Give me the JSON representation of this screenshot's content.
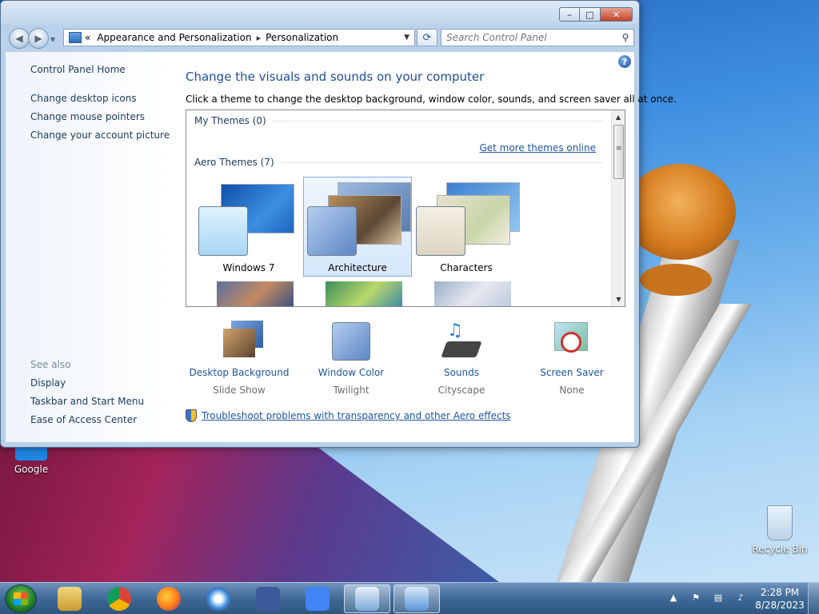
{
  "desktop": {
    "icons": [
      {
        "label": "Google"
      },
      {
        "label": "Recycle Bin"
      }
    ]
  },
  "window": {
    "caption": {
      "minimize": "–",
      "maximize": "□",
      "close": "✕"
    },
    "nav": {
      "back_icon": "back-arrow-icon",
      "forward_icon": "forward-arrow-icon",
      "breadcrumb_prefix": "«",
      "breadcrumb": [
        "Appearance and Personalization",
        "Personalization"
      ],
      "breadcrumb_sep": "▸",
      "dropdown": "▼",
      "refresh": "⟳",
      "search_placeholder": "Search Control Panel"
    },
    "left_pane": {
      "home": "Control Panel Home",
      "links": [
        "Change desktop icons",
        "Change mouse pointers",
        "Change your account picture"
      ],
      "see_also_label": "See also",
      "see_also": [
        "Display",
        "Taskbar and Start Menu",
        "Ease of Access Center"
      ]
    },
    "main": {
      "help": "?",
      "title": "Change the visuals and sounds on your computer",
      "subtitle": "Click a theme to change the desktop background, window color, sounds, and screen saver all at once.",
      "my_themes": "My Themes (0)",
      "get_more": "Get more themes online",
      "aero_themes": "Aero Themes (7)",
      "themes": [
        {
          "name": "Windows 7",
          "selected": false,
          "colors": [
            "#1b5fb0",
            "#bfe3fb"
          ]
        },
        {
          "name": "Architecture",
          "selected": true,
          "colors": [
            "#7a6a58",
            "#a6c3ea"
          ]
        },
        {
          "name": "Characters",
          "selected": false,
          "colors": [
            "#4a8fd1",
            "#e9e4d6"
          ]
        }
      ],
      "settings": [
        {
          "name": "Desktop Background",
          "value": "Slide Show"
        },
        {
          "name": "Window Color",
          "value": "Twilight"
        },
        {
          "name": "Sounds",
          "value": "Cityscape"
        },
        {
          "name": "Screen Saver",
          "value": "None"
        }
      ],
      "troubleshoot": "Troubleshoot problems with transparency and other Aero effects"
    }
  },
  "taskbar": {
    "apps": [
      {
        "name": "windows-explorer",
        "color": "#e6c15a"
      },
      {
        "name": "google-chrome",
        "color": "#db4437"
      },
      {
        "name": "firefox",
        "color": "#ff7a1a"
      },
      {
        "name": "app-s",
        "color": "#2b82d9"
      },
      {
        "name": "facebook",
        "color": "#3b5998"
      },
      {
        "name": "google-search",
        "color": "#4285f4"
      },
      {
        "name": "keyboard-app",
        "color": "#7ea8d8",
        "active": true
      },
      {
        "name": "control-panel",
        "color": "#5b95d8",
        "active": true
      }
    ],
    "tray": {
      "time": "2:28 PM",
      "date": "8/28/2023"
    }
  }
}
